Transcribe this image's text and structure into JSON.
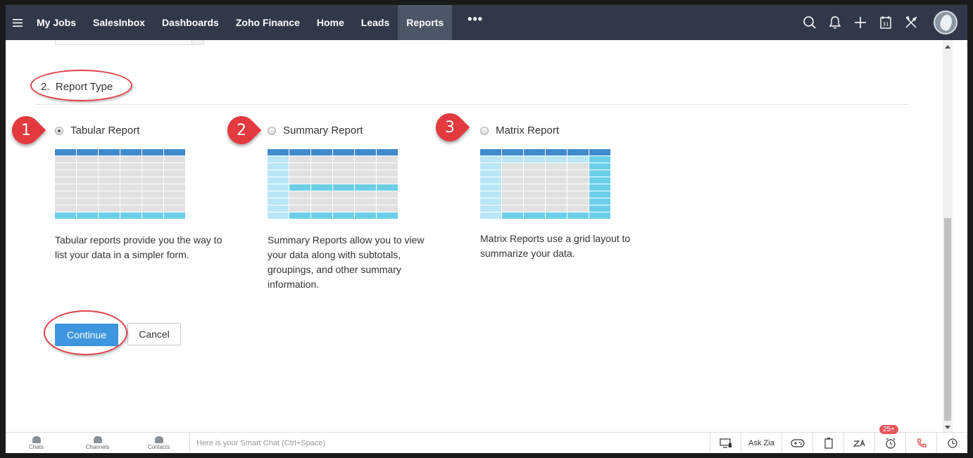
{
  "nav": {
    "items": [
      {
        "label": "My Jobs",
        "active": false
      },
      {
        "label": "SalesInbox",
        "active": false
      },
      {
        "label": "Dashboards",
        "active": false
      },
      {
        "label": "Zoho Finance",
        "active": false
      },
      {
        "label": "Home",
        "active": false
      },
      {
        "label": "Leads",
        "active": false
      },
      {
        "label": "Reports",
        "active": true
      }
    ],
    "more": "•••",
    "icons": [
      "search-icon",
      "bell-icon",
      "plus-icon",
      "calendar-icon",
      "tools-icon",
      "avatar"
    ],
    "calendar_day": "31"
  },
  "section": {
    "number": "2.",
    "title": "Report Type"
  },
  "options": [
    {
      "marker": "1",
      "label": "Tabular Report",
      "selected": true,
      "description_lines": [
        "Tabular reports provide you the way to",
        "list your data in a simpler form."
      ]
    },
    {
      "marker": "2",
      "label": "Summary Report",
      "selected": false,
      "description_lines": [
        "Summary Reports allow you to view",
        "your data along with subtotals,",
        "groupings, and other summary",
        "information."
      ]
    },
    {
      "marker": "3",
      "label": "Matrix Report",
      "selected": false,
      "description_lines": [
        "Matrix Reports use a grid layout to",
        "summarize your data."
      ]
    }
  ],
  "buttons": {
    "continue": "Continue",
    "cancel": "Cancel"
  },
  "bottombar": {
    "left": [
      {
        "label": "Chats",
        "icon": "chat-icon"
      },
      {
        "label": "Channels",
        "icon": "channels-icon"
      },
      {
        "label": "Contacts",
        "icon": "contacts-icon"
      }
    ],
    "chat_placeholder": "Here is your Smart Chat (Ctrl+Space)",
    "ask_zia": "Ask Zia",
    "badge": "25+",
    "right_icons": [
      "screen-icon",
      "ask-zia",
      "gamepad-icon",
      "notes-icon",
      "zia-signature-icon",
      "alarm-icon",
      "phone-icon",
      "history-icon"
    ]
  },
  "colors": {
    "nav_bg": "#313949",
    "nav_active": "#4c5667",
    "accent": "#3d96de",
    "annotation_red": "#e0434b",
    "grid_header": "#3f8bcb",
    "grid_light": "#b9e6f5",
    "grid_mid": "#6ccfe8",
    "grid_gray": "#e1e1e1"
  }
}
